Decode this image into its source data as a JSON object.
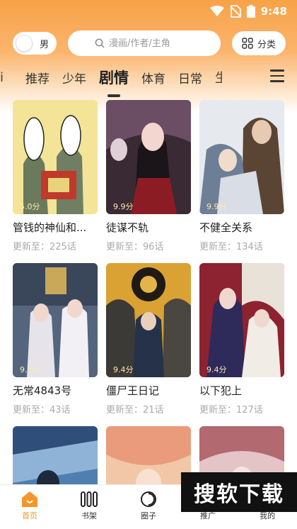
{
  "status_bar": {
    "time": "9:48"
  },
  "header": {
    "gender_label": "男",
    "search_placeholder": "漫画/作者/主角",
    "category_label": "分类"
  },
  "tabs": {
    "partial_left": "i",
    "items": [
      "推荐",
      "少年",
      "剧情",
      "体育",
      "日常"
    ],
    "active_index": 2,
    "partial_right": "生"
  },
  "comics": [
    {
      "title": "管钱的神仙和...",
      "score": "5.0分",
      "update": "更新至：225话"
    },
    {
      "title": "徒谋不轨",
      "score": "9.9分",
      "update": "更新至：96话"
    },
    {
      "title": "不健全关系",
      "score": "9.9分",
      "update": "更新至：134话"
    },
    {
      "title": "无常4843号",
      "score": "9.3分",
      "update": "更新至：43话"
    },
    {
      "title": "僵尸王日记",
      "score": "9.4分",
      "update": "更新至：21话"
    },
    {
      "title": "以下犯上",
      "score": "9.4分",
      "update": "更新至：127话"
    },
    {
      "title": "",
      "score": "",
      "update": ""
    },
    {
      "title": "",
      "score": "",
      "update": ""
    },
    {
      "title": "",
      "score": "",
      "update": ""
    }
  ],
  "bottom_nav": {
    "items": [
      "首页",
      "书架",
      "圈子",
      "推广",
      "我的"
    ],
    "active_index": 0
  },
  "watermark": "搜软下载",
  "colors": {
    "accent": "#f5962a",
    "header_top": "#f8a247"
  }
}
